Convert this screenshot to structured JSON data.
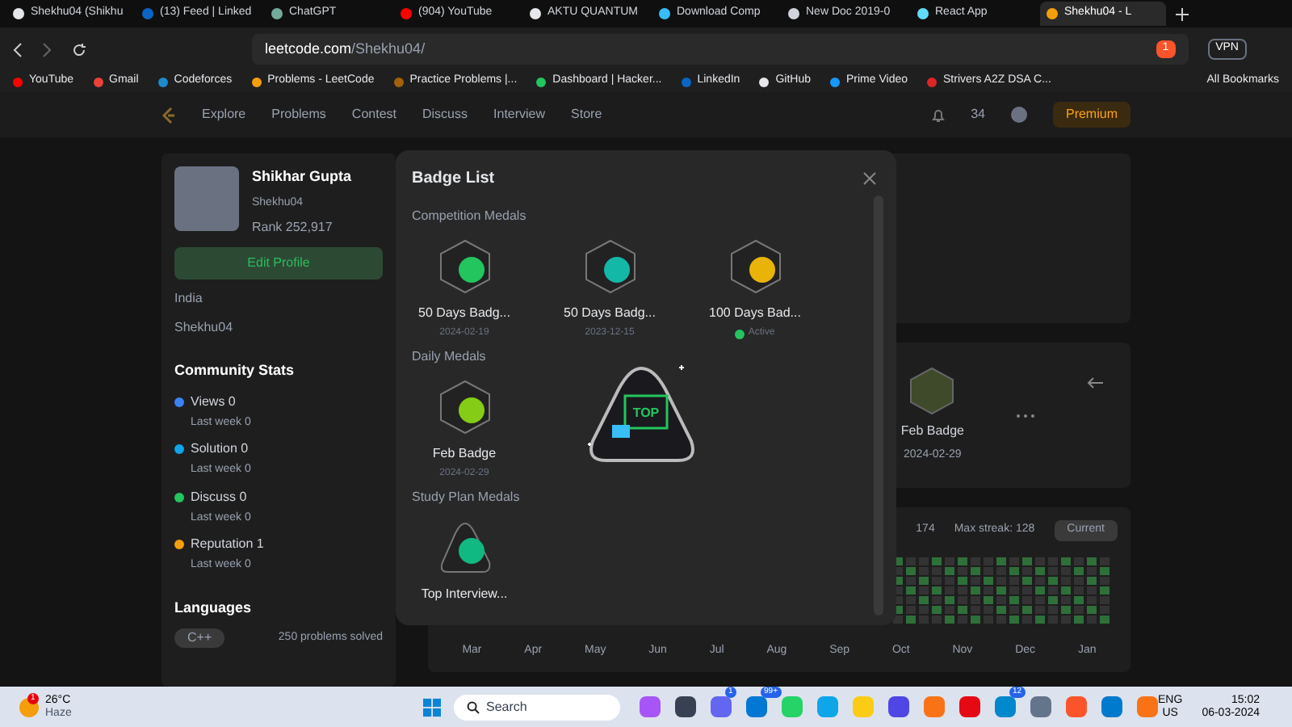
{
  "browser": {
    "tabs": [
      {
        "label": "Shekhu04 (Shikhu",
        "selected": false,
        "color": "#e5e7eb"
      },
      {
        "label": "(13) Feed | Linked",
        "selected": false,
        "color": "#0a66c2"
      },
      {
        "label": "ChatGPT",
        "selected": false,
        "color": "#74aa9c"
      },
      {
        "label": "(904) YouTube",
        "selected": false,
        "color": "#ff0000"
      },
      {
        "label": "AKTU QUANTUM",
        "selected": false,
        "color": "#e5e7eb"
      },
      {
        "label": "Download Comp",
        "selected": false,
        "color": "#38bdf8"
      },
      {
        "label": "New Doc 2019-0",
        "selected": false,
        "color": "#d1d5db"
      },
      {
        "label": "React App",
        "selected": false,
        "color": "#61dafb"
      },
      {
        "label": "Shekhu04 - L",
        "selected": true,
        "color": "#f59e0b"
      }
    ],
    "address": {
      "host": "leetcode.com",
      "path": "/Shekhu04/"
    },
    "shield_count": "1",
    "vpn": "VPN",
    "bookmarks": [
      {
        "label": "YouTube",
        "color": "#ff0000"
      },
      {
        "label": "Gmail",
        "color": "#ea4335"
      },
      {
        "label": "Codeforces",
        "color": "#1f8acb"
      },
      {
        "label": "Problems - LeetCode",
        "color": "#f59e0b"
      },
      {
        "label": "Practice Problems |...",
        "color": "#a16207"
      },
      {
        "label": "Dashboard | Hacker...",
        "color": "#22c55e"
      },
      {
        "label": "LinkedIn",
        "color": "#0a66c2"
      },
      {
        "label": "GitHub",
        "color": "#e5e7eb"
      },
      {
        "label": "Prime Video",
        "color": "#1399ff"
      },
      {
        "label": "Strivers A2Z DSA C...",
        "color": "#dc2626"
      }
    ],
    "all_bookmarks": "All Bookmarks"
  },
  "site": {
    "nav": [
      "Explore",
      "Problems",
      "Contest",
      "Discuss",
      "Interview",
      "Store"
    ],
    "streak": "34",
    "premium": "Premium",
    "profile": {
      "name": "Shikhar Gupta",
      "username": "Shekhu04",
      "rank_label": "Rank",
      "rank": "252,917",
      "edit": "Edit Profile",
      "location": "India",
      "github": "Shekhu04"
    },
    "community": {
      "title": "Community Stats",
      "stats": [
        {
          "label": "Views",
          "value": "0",
          "sub": "Last week 0",
          "color": "#3b82f6"
        },
        {
          "label": "Solution",
          "value": "0",
          "sub": "Last week 0",
          "color": "#0ea5e9"
        },
        {
          "label": "Discuss",
          "value": "0",
          "sub": "Last week 0",
          "color": "#22c55e"
        },
        {
          "label": "Reputation",
          "value": "1",
          "sub": "Last week 0",
          "color": "#f59e0b"
        }
      ]
    },
    "languages": {
      "title": "Languages",
      "items": [
        {
          "name": "C++",
          "solved": "250",
          "unit": "problems solved"
        }
      ]
    },
    "badge_panel": {
      "name": "Feb Badge",
      "date": "2024-02-29"
    },
    "calendar": {
      "total_active": "174",
      "max_streak": "Max streak: 128",
      "select": "Current",
      "months": [
        "Mar",
        "Apr",
        "May",
        "Jun",
        "Jul",
        "Aug",
        "Sep",
        "Oct",
        "Nov",
        "Dec",
        "Jan"
      ]
    }
  },
  "modal": {
    "title": "Badge List",
    "sections": [
      {
        "title": "Competition Medals",
        "badges": [
          {
            "name": "50 Days Badg...",
            "kind": "date",
            "date": "2024-02-19",
            "color": "#22c55e"
          },
          {
            "name": "50 Days Badg...",
            "kind": "date",
            "date": "2023-12-15",
            "color": "#14b8a6"
          },
          {
            "name": "100 Days Bad...",
            "kind": "active",
            "status": "Active",
            "color": "#eab308"
          }
        ]
      },
      {
        "title": "Daily Medals",
        "badges": [
          {
            "name": "Feb Badge",
            "kind": "date",
            "date": "2024-02-29",
            "color": "#84cc16"
          }
        ]
      },
      {
        "title": "Study Plan Medals",
        "badges": [
          {
            "name": "Top Interview...",
            "kind": "study",
            "color": "#10b981"
          }
        ]
      }
    ],
    "preview": {
      "label": "TOP"
    }
  },
  "taskbar": {
    "weather": {
      "temp": "26°C",
      "desc": "Haze",
      "badge": "1"
    },
    "search": "Search",
    "apps": [
      {
        "color": "#a855f7"
      },
      {
        "color": "#374151"
      },
      {
        "color": "#6366f1",
        "badge": "1"
      },
      {
        "color": "#0078d4",
        "badge": "99+"
      },
      {
        "color": "#25d366"
      },
      {
        "color": "#0ea5e9"
      },
      {
        "color": "#facc15"
      },
      {
        "color": "#4f46e5"
      },
      {
        "color": "#f97316"
      },
      {
        "color": "#e50914"
      },
      {
        "color": "#0088cc",
        "badge": "12"
      },
      {
        "color": "#64748b"
      },
      {
        "color": "#fb542b"
      },
      {
        "color": "#007acc"
      },
      {
        "color": "#f97316"
      }
    ],
    "lang": "ENG",
    "region": "US",
    "time": "15:02",
    "date": "06-03-2024"
  }
}
